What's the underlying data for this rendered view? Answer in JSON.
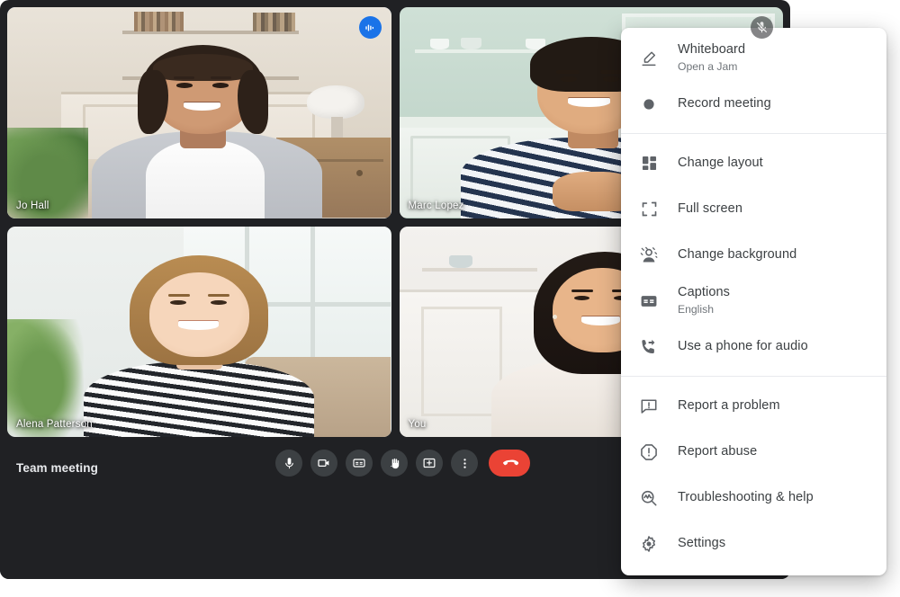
{
  "meeting": {
    "title": "Team meeting"
  },
  "participants": [
    {
      "name": "Jo Hall",
      "badge": "audio-active-icon",
      "active_speaker": true,
      "scene": "living-room"
    },
    {
      "name": "Marc Lopez",
      "badge": "mic-off-icon",
      "active_speaker": false,
      "scene": "kitchen"
    },
    {
      "name": "Alena Patterson",
      "badge": "",
      "active_speaker": false,
      "scene": "bright-room"
    },
    {
      "name": "You",
      "badge": "",
      "active_speaker": false,
      "scene": "white-room"
    }
  ],
  "controls": [
    {
      "name": "microphone-button",
      "icon": "mic-icon",
      "label": "Turn off microphone"
    },
    {
      "name": "camera-button",
      "icon": "video-camera-icon",
      "label": "Turn off camera"
    },
    {
      "name": "captions-button",
      "icon": "cc-icon",
      "label": "Turn on captions"
    },
    {
      "name": "raise-hand-button",
      "icon": "hand-icon",
      "label": "Raise hand"
    },
    {
      "name": "present-now-button",
      "icon": "present-screen-icon",
      "label": "Present now"
    },
    {
      "name": "more-options-button",
      "icon": "more-vertical-icon",
      "label": "More options"
    },
    {
      "name": "leave-call-button",
      "icon": "end-call-icon",
      "label": "Leave call"
    }
  ],
  "options_menu": {
    "groups": [
      {
        "items": [
          {
            "label": "Whiteboard",
            "sublabel": "Open a Jam",
            "icon": "whiteboard-pen-icon"
          },
          {
            "label": "Record meeting",
            "sublabel": "",
            "icon": "record-dot-icon"
          }
        ]
      },
      {
        "items": [
          {
            "label": "Change layout",
            "sublabel": "",
            "icon": "layout-grid-icon"
          },
          {
            "label": "Full screen",
            "sublabel": "",
            "icon": "fullscreen-icon"
          },
          {
            "label": "Change background",
            "sublabel": "",
            "icon": "change-background-icon"
          },
          {
            "label": "Captions",
            "sublabel": "English",
            "icon": "cc-box-icon"
          },
          {
            "label": "Use a phone for audio",
            "sublabel": "",
            "icon": "phone-forward-icon"
          }
        ]
      },
      {
        "items": [
          {
            "label": "Report a problem",
            "sublabel": "",
            "icon": "feedback-icon"
          },
          {
            "label": "Report abuse",
            "sublabel": "",
            "icon": "report-abuse-icon"
          },
          {
            "label": "Troubleshooting & help",
            "sublabel": "",
            "icon": "troubleshoot-icon"
          },
          {
            "label": "Settings",
            "sublabel": "",
            "icon": "gear-icon"
          }
        ]
      }
    ]
  },
  "colors": {
    "window_background": "#202124",
    "control_background": "#3c4043",
    "end_call": "#ea4335",
    "active_speaker_border": "#8ab4f8",
    "speaking_badge": "#1a73e8",
    "menu_background": "#ffffff",
    "menu_label": "#3c4043",
    "menu_sublabel": "#70757a",
    "menu_icon": "#5f6368"
  }
}
